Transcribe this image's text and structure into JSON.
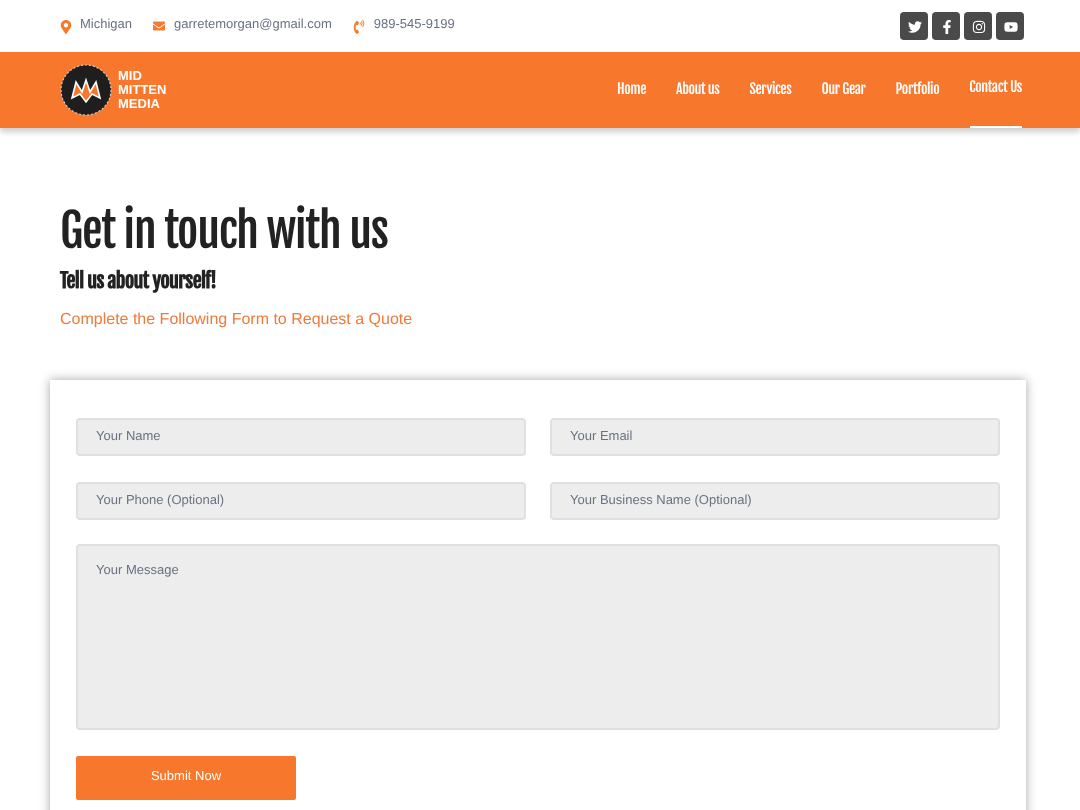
{
  "topbar": {
    "location": "Michigan",
    "email": "garretemorgan@gmail.com",
    "phone": "989-545-9199",
    "social": [
      {
        "kind": "twitter"
      },
      {
        "kind": "facebook"
      },
      {
        "kind": "instagram"
      },
      {
        "kind": "youtube"
      }
    ]
  },
  "logo": {
    "lines": [
      "MID",
      "MITTEN",
      "MEDIA"
    ]
  },
  "nav": [
    {
      "label": "Home",
      "selected": false
    },
    {
      "label": "About us",
      "selected": false
    },
    {
      "label": "Services",
      "selected": false
    },
    {
      "label": "Our Gear",
      "selected": false
    },
    {
      "label": "Portfolio",
      "selected": false
    },
    {
      "label": "Contact Us",
      "selected": true
    }
  ],
  "heading": "Get in touch with us",
  "subheading": "Tell us about yourself!",
  "intro": "Complete the Following Form to Request a Quote",
  "form": {
    "fields": [
      {
        "placeholder": "Your Name"
      },
      {
        "placeholder": "Your Email"
      },
      {
        "placeholder": "Your Phone (Optional)"
      },
      {
        "placeholder": "Your Business Name (Optional)"
      }
    ],
    "message": {
      "placeholder": "Your Message"
    },
    "submit": "Submit Now"
  }
}
